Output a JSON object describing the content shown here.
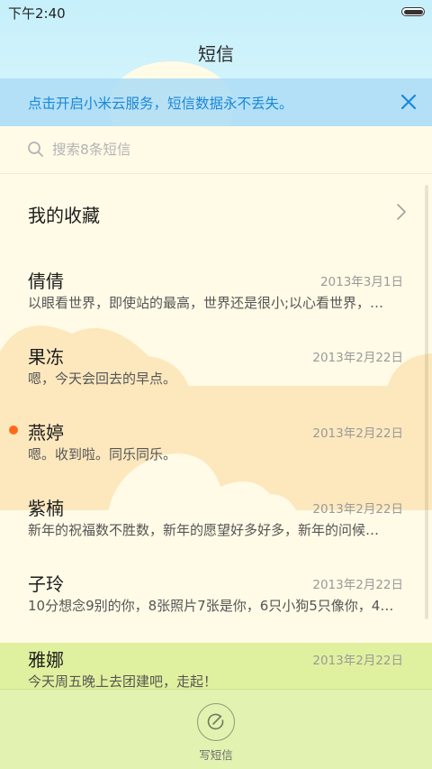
{
  "status_bar": {
    "time": "下午2:40"
  },
  "header": {
    "title": "短信"
  },
  "cloud_banner": {
    "text": "点击开启小米云服务，短信数据永不丢失。"
  },
  "search": {
    "placeholder": "搜索8条短信"
  },
  "favorites": {
    "label": "我的收藏"
  },
  "messages": [
    {
      "name": "倩倩",
      "date": "2013年3月1日",
      "preview": "以眼看世界，即使站的最高，世界还是很小;以心看世界，…",
      "unread": false
    },
    {
      "name": "果冻",
      "date": "2013年2月22日",
      "preview": "嗯，今天会回去的早点。",
      "unread": false
    },
    {
      "name": "燕婷",
      "date": "2013年2月22日",
      "preview": "嗯。收到啦。同乐同乐。",
      "unread": true
    },
    {
      "name": "紫楠",
      "date": "2013年2月22日",
      "preview": "新年的祝福数不胜数，新年的愿望好多好多，新年的问候…",
      "unread": false
    },
    {
      "name": "子玲",
      "date": "2013年2月22日",
      "preview": "10分想念9别的你，8张照片7张是你，6只小狗5只像你，4…",
      "unread": false
    },
    {
      "name": "雅娜",
      "date": "2013年2月22日",
      "preview": "今天周五晚上去团建吧，走起！",
      "unread": false
    }
  ],
  "compose": {
    "label": "写短信"
  },
  "colors": {
    "sky": "#c8f0fb",
    "cloud_banner": "#addcf6",
    "accent_blue": "#1a88d9",
    "list_bg": "#fffbe6",
    "sand": "#fde8be",
    "grass": "#e2f2b0",
    "unread_dot": "#ff6a1a"
  }
}
